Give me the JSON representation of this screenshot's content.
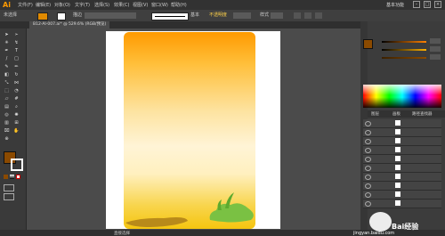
{
  "app": {
    "logo": "Ai"
  },
  "menu": [
    "文件(F)",
    "编辑(E)",
    "对象(O)",
    "文字(T)",
    "选择(S)",
    "效果(C)",
    "视图(V)",
    "窗口(W)",
    "帮助(H)"
  ],
  "window": {
    "workspace": "基本功能",
    "search_placeholder": ""
  },
  "controlbar": {
    "stroke_label": "描边",
    "stroke_value": "",
    "profile": "基本",
    "opacity_label": "不透明度",
    "style_label": "样式"
  },
  "document": {
    "tab_title": "B12-AI-007.ai* @ 529.6% (RGB/预览)"
  },
  "status": {
    "zoom": "",
    "mode": "直接选择"
  },
  "watermark": {
    "brand": "Bai经验",
    "url": "jingyan.baidu.com"
  },
  "colors": {
    "fill": "#8b4a00",
    "accent": "#ff9a00"
  },
  "panel": {
    "tabs": [
      "图层",
      "画板",
      "路径查找器"
    ]
  },
  "icons": [
    "selection-tool-icon",
    "direct-selection-icon",
    "magic-wand-icon",
    "lasso-icon",
    "pen-icon",
    "type-icon",
    "line-icon",
    "rectangle-icon",
    "brush-icon",
    "pencil-icon",
    "eraser-icon",
    "rotate-icon",
    "scale-icon",
    "width-icon",
    "free-transform-icon",
    "shape-builder-icon",
    "perspective-icon",
    "mesh-icon",
    "gradient-icon",
    "eyedropper-icon",
    "blend-icon",
    "symbol-sprayer-icon",
    "graph-icon",
    "artboard-icon",
    "slice-icon",
    "hand-icon",
    "zoom-icon"
  ]
}
